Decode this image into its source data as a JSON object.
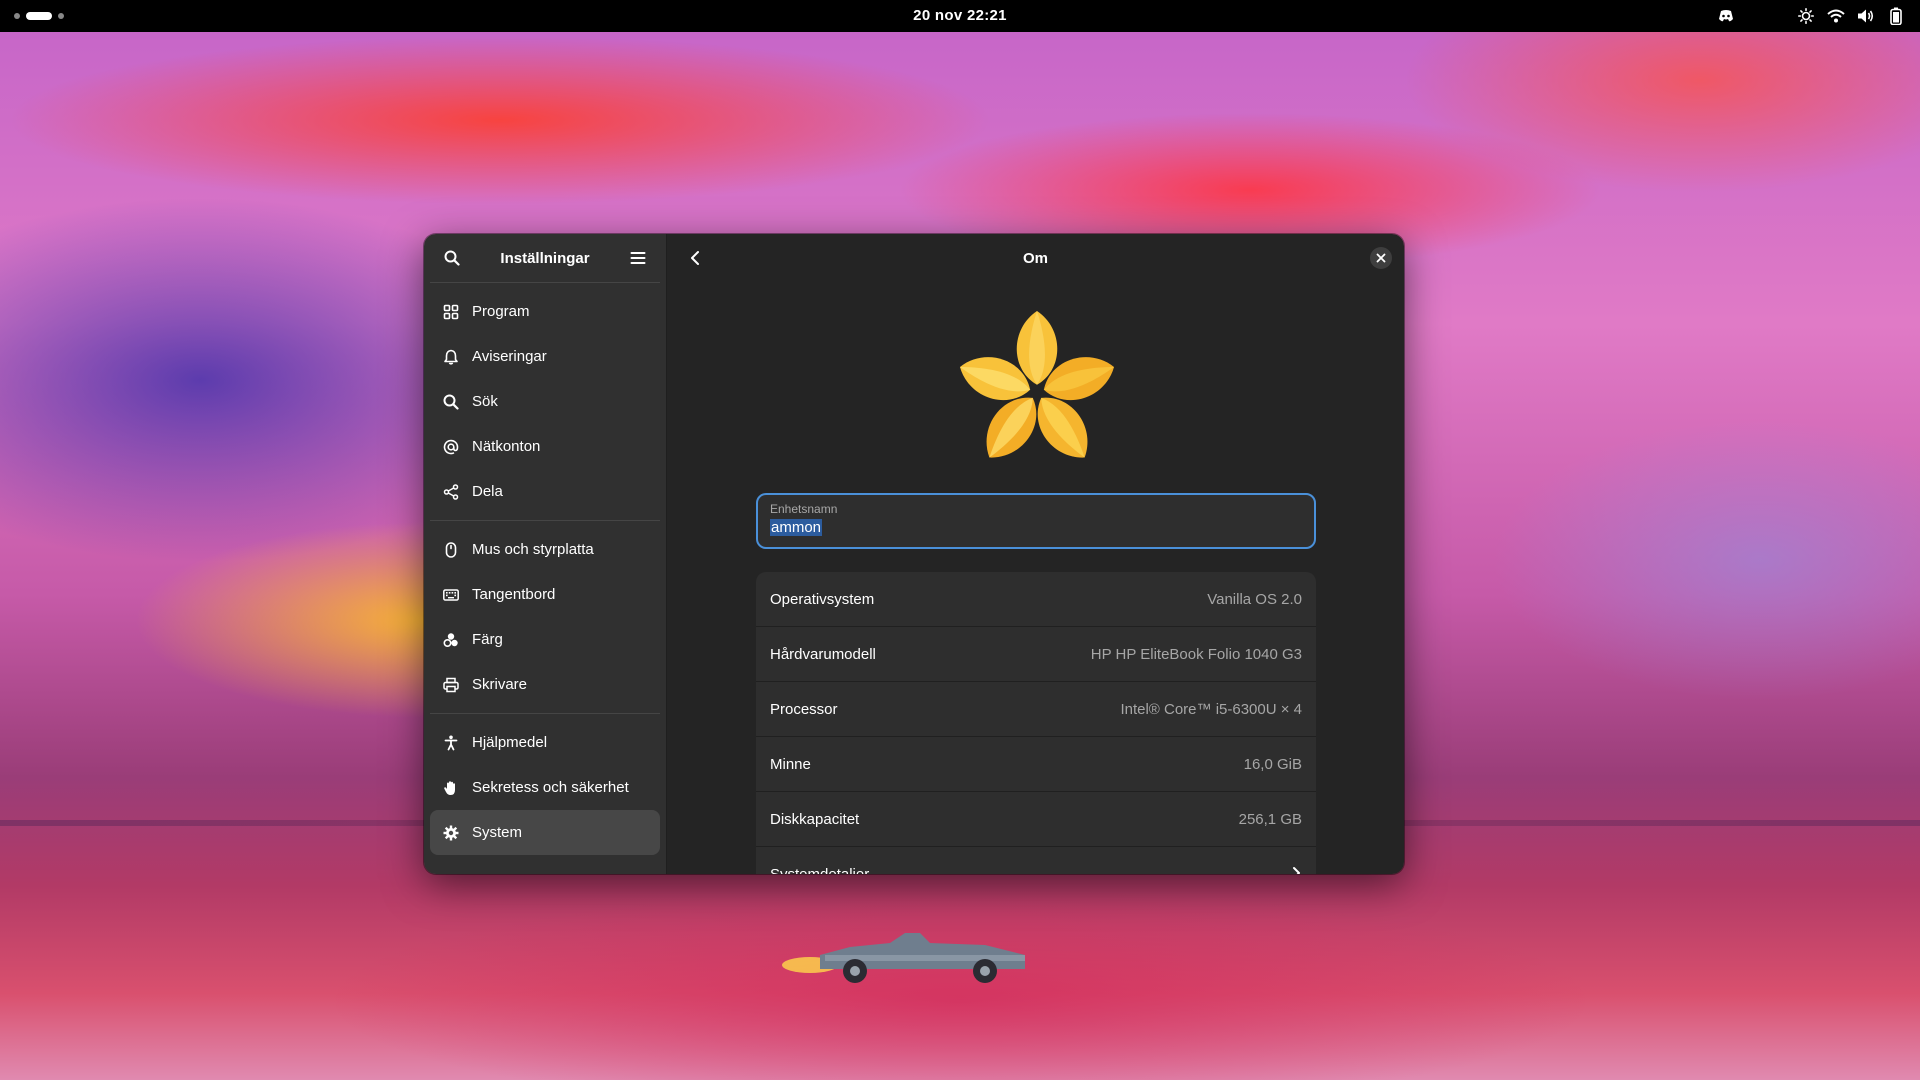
{
  "topbar": {
    "clock": "20 nov  22:21",
    "icons": [
      "workspace-indicator",
      "discord-icon",
      "brightness-icon",
      "wifi-icon",
      "volume-icon",
      "battery-icon"
    ]
  },
  "sidebar": {
    "title": "Inställningar",
    "groups": [
      [
        {
          "label": "Program",
          "icon": "apps-icon"
        },
        {
          "label": "Aviseringar",
          "icon": "bell-icon"
        },
        {
          "label": "Sök",
          "icon": "search-icon"
        },
        {
          "label": "Nätkonton",
          "icon": "at-icon"
        },
        {
          "label": "Dela",
          "icon": "share-icon"
        }
      ],
      [
        {
          "label": "Mus och styrplatta",
          "icon": "mouse-icon"
        },
        {
          "label": "Tangentbord",
          "icon": "keyboard-icon"
        },
        {
          "label": "Färg",
          "icon": "color-icon"
        },
        {
          "label": "Skrivare",
          "icon": "printer-icon"
        }
      ],
      [
        {
          "label": "Hjälpmedel",
          "icon": "accessibility-icon"
        },
        {
          "label": "Sekretess och säkerhet",
          "icon": "hand-icon"
        },
        {
          "label": "System",
          "icon": "gear-icon",
          "active": true
        }
      ]
    ]
  },
  "content": {
    "title": "Om",
    "device_name": {
      "label": "Enhetsnamn",
      "value": "ammon"
    },
    "rows": [
      {
        "label": "Operativsystem",
        "value": "Vanilla OS 2.0"
      },
      {
        "label": "Hårdvarumodell",
        "value": "HP HP EliteBook Folio 1040 G3"
      },
      {
        "label": "Processor",
        "value": "Intel® Core™ i5-6300U × 4"
      },
      {
        "label": "Minne",
        "value": "16,0 GiB"
      },
      {
        "label": "Diskkapacitet",
        "value": "256,1 GB"
      },
      {
        "label": "Systemdetaljer",
        "value": ""
      }
    ]
  },
  "colors": {
    "accent": "#4a90d9",
    "window_bg": "#242424",
    "sidebar_bg": "#303030",
    "logo": "#f8c23a"
  }
}
